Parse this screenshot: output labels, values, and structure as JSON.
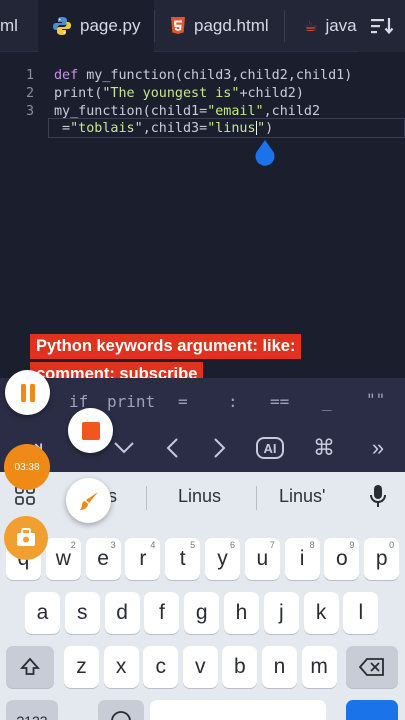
{
  "tabs": [
    {
      "label": "ml",
      "icon": "none"
    },
    {
      "label": "page.py",
      "icon": "python-icon"
    },
    {
      "label": "pagd.html",
      "icon": "html5-icon"
    },
    {
      "label": "java",
      "icon": "java-icon"
    }
  ],
  "editor": {
    "line_numbers": [
      "1",
      "2",
      "3"
    ],
    "lines": {
      "l1": {
        "kw": "def",
        "rest": " my_function(child3,child2,child1)"
      },
      "l2": {
        "a": "print(",
        "s": "\"The youngest is\"",
        "b": "+child2)"
      },
      "l3": {
        "a": "my_function(child1=",
        "s": "\"email\"",
        "b": ",child2"
      },
      "l4": {
        "a": " =",
        "s1": "\"toblais\"",
        "b": ",child3=",
        "s2": "\"linus",
        "s3": "\"",
        "c": ")"
      }
    }
  },
  "captions": {
    "line1": "Python keywords argument: like:",
    "line2": "comment: subscribe"
  },
  "symbols": [
    "if",
    "print",
    "=",
    ":",
    "==",
    "_",
    "\"\""
  ],
  "recorder": {
    "timer": "03:38"
  },
  "keyboard": {
    "suggestions": [
      "s",
      "Linus",
      "Linus'"
    ],
    "row1": [
      {
        "k": "q",
        "h": "1"
      },
      {
        "k": "w",
        "h": "2"
      },
      {
        "k": "e",
        "h": "3"
      },
      {
        "k": "r",
        "h": "4"
      },
      {
        "k": "t",
        "h": "5"
      },
      {
        "k": "y",
        "h": "6"
      },
      {
        "k": "u",
        "h": "7"
      },
      {
        "k": "i",
        "h": "8"
      },
      {
        "k": "o",
        "h": "9"
      },
      {
        "k": "p",
        "h": "0"
      }
    ],
    "row2": [
      "a",
      "s",
      "d",
      "f",
      "g",
      "h",
      "j",
      "k",
      "l"
    ],
    "row3": [
      "z",
      "x",
      "c",
      "v",
      "b",
      "n",
      "m"
    ],
    "row4": {
      "sym_label": "?123"
    }
  },
  "colors": {
    "accent": "#1a73e8",
    "caption_bg": "#e0321e",
    "timer": "#f08a16"
  }
}
